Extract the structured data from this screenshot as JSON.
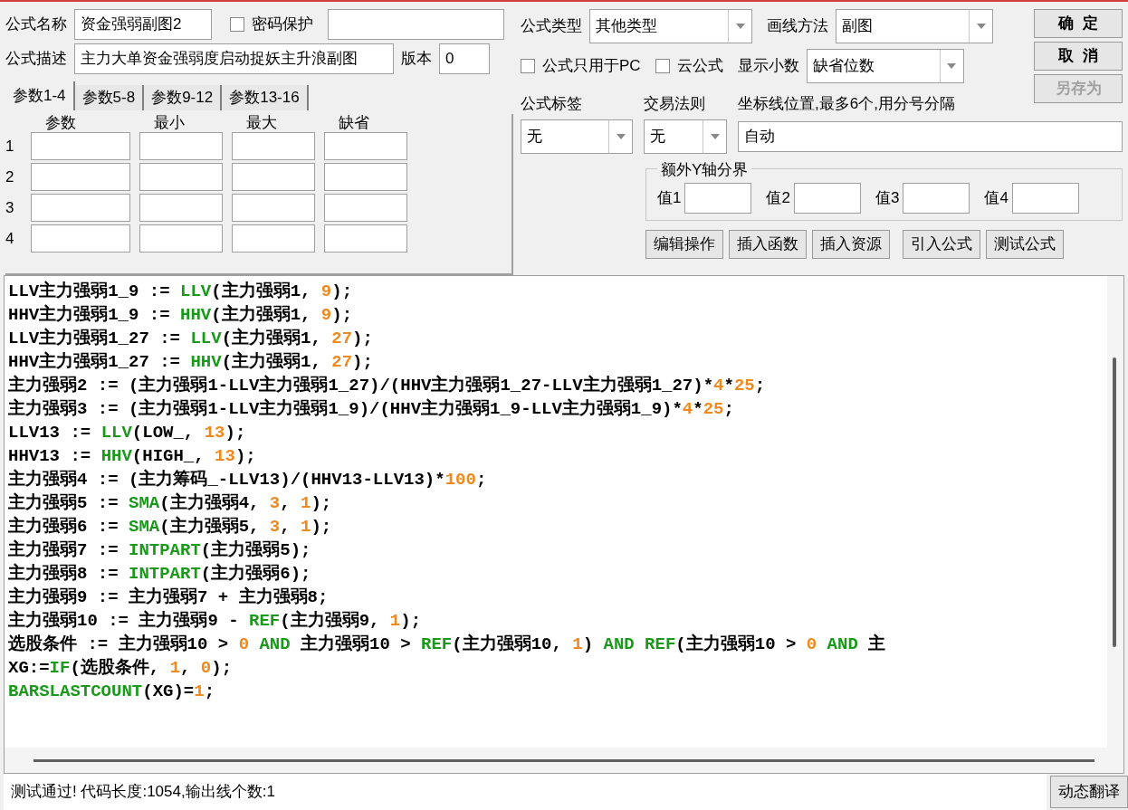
{
  "name_field": {
    "label": "公式名称",
    "value": "资金强弱副图2"
  },
  "password": {
    "label": "密码保护",
    "checked": false
  },
  "desc_field": {
    "label": "公式描述",
    "value": "主力大单资金强弱度启动捉妖主升浪副图"
  },
  "version": {
    "label": "版本",
    "value": "0"
  },
  "formula_type": {
    "label": "公式类型",
    "value": "其他类型"
  },
  "draw_method": {
    "label": "画线方法",
    "value": "副图"
  },
  "pc_only": {
    "label": "公式只用于PC",
    "checked": false
  },
  "cloud": {
    "label": "云公式",
    "checked": false
  },
  "decimals": {
    "label": "显示小数",
    "value": "缺省位数"
  },
  "buttons": [
    {
      "label": "确  定",
      "disabled": false
    },
    {
      "label": "取  消",
      "disabled": false
    },
    {
      "label": "另存为",
      "disabled": true
    }
  ],
  "tabs": [
    {
      "label": "参数1-4",
      "selected": true
    },
    {
      "label": "参数5-8",
      "selected": false
    },
    {
      "label": "参数9-12",
      "selected": false
    },
    {
      "label": "参数13-16",
      "selected": false
    }
  ],
  "param_columns": [
    "参数",
    "最小",
    "最大",
    "缺省"
  ],
  "param_rows": [
    "1",
    "2",
    "3",
    "4"
  ],
  "tag": {
    "label": "公式标签",
    "value": "无"
  },
  "trade_rule": {
    "label": "交易法则",
    "value": "无"
  },
  "axis": {
    "label": "坐标线位置,最多6个,用分号分隔",
    "value": "自动"
  },
  "y_bounds": {
    "title": "额外Y轴分界",
    "fields": [
      "值1",
      "值2",
      "值3",
      "值4"
    ]
  },
  "actions": [
    "编辑操作",
    "插入函数",
    "插入资源",
    "引入公式",
    "测试公式"
  ],
  "code": [
    [
      {
        "kind": "plain",
        "text": "LLV主力强弱1_9 := "
      },
      {
        "kind": "function",
        "text": "LLV"
      },
      {
        "kind": "plain",
        "text": "(主力强弱1, "
      },
      {
        "kind": "number",
        "text": "9"
      },
      {
        "kind": "plain",
        "text": ");"
      }
    ],
    [
      {
        "kind": "plain",
        "text": "HHV主力强弱1_9 := "
      },
      {
        "kind": "function",
        "text": "HHV"
      },
      {
        "kind": "plain",
        "text": "(主力强弱1, "
      },
      {
        "kind": "number",
        "text": "9"
      },
      {
        "kind": "plain",
        "text": ");"
      }
    ],
    [
      {
        "kind": "plain",
        "text": "LLV主力强弱1_27 := "
      },
      {
        "kind": "function",
        "text": "LLV"
      },
      {
        "kind": "plain",
        "text": "(主力强弱1, "
      },
      {
        "kind": "number",
        "text": "27"
      },
      {
        "kind": "plain",
        "text": ");"
      }
    ],
    [
      {
        "kind": "plain",
        "text": "HHV主力强弱1_27 := "
      },
      {
        "kind": "function",
        "text": "HHV"
      },
      {
        "kind": "plain",
        "text": "(主力强弱1, "
      },
      {
        "kind": "number",
        "text": "27"
      },
      {
        "kind": "plain",
        "text": ");"
      }
    ],
    [
      {
        "kind": "plain",
        "text": "主力强弱2 := (主力强弱1-LLV主力强弱1_27)/(HHV主力强弱1_27-LLV主力强弱1_27)*"
      },
      {
        "kind": "number",
        "text": "4"
      },
      {
        "kind": "plain",
        "text": "*"
      },
      {
        "kind": "number",
        "text": "25"
      },
      {
        "kind": "plain",
        "text": ";"
      }
    ],
    [
      {
        "kind": "plain",
        "text": "主力强弱3 := (主力强弱1-LLV主力强弱1_9)/(HHV主力强弱1_9-LLV主力强弱1_9)*"
      },
      {
        "kind": "number",
        "text": "4"
      },
      {
        "kind": "plain",
        "text": "*"
      },
      {
        "kind": "number",
        "text": "25"
      },
      {
        "kind": "plain",
        "text": ";"
      }
    ],
    [
      {
        "kind": "plain",
        "text": "LLV13 := "
      },
      {
        "kind": "function",
        "text": "LLV"
      },
      {
        "kind": "plain",
        "text": "(LOW_, "
      },
      {
        "kind": "number",
        "text": "13"
      },
      {
        "kind": "plain",
        "text": ");"
      }
    ],
    [
      {
        "kind": "plain",
        "text": "HHV13 := "
      },
      {
        "kind": "function",
        "text": "HHV"
      },
      {
        "kind": "plain",
        "text": "(HIGH_, "
      },
      {
        "kind": "number",
        "text": "13"
      },
      {
        "kind": "plain",
        "text": ");"
      }
    ],
    [
      {
        "kind": "plain",
        "text": "主力强弱4 := (主力筹码_-LLV13)/(HHV13-LLV13)*"
      },
      {
        "kind": "number",
        "text": "100"
      },
      {
        "kind": "plain",
        "text": ";"
      }
    ],
    [
      {
        "kind": "plain",
        "text": "主力强弱5 := "
      },
      {
        "kind": "function",
        "text": "SMA"
      },
      {
        "kind": "plain",
        "text": "(主力强弱4, "
      },
      {
        "kind": "number",
        "text": "3"
      },
      {
        "kind": "plain",
        "text": ", "
      },
      {
        "kind": "number",
        "text": "1"
      },
      {
        "kind": "plain",
        "text": ");"
      }
    ],
    [
      {
        "kind": "plain",
        "text": "主力强弱6 := "
      },
      {
        "kind": "function",
        "text": "SMA"
      },
      {
        "kind": "plain",
        "text": "(主力强弱5, "
      },
      {
        "kind": "number",
        "text": "3"
      },
      {
        "kind": "plain",
        "text": ", "
      },
      {
        "kind": "number",
        "text": "1"
      },
      {
        "kind": "plain",
        "text": ");"
      }
    ],
    [
      {
        "kind": "plain",
        "text": "主力强弱7 := "
      },
      {
        "kind": "function",
        "text": "INTPART"
      },
      {
        "kind": "plain",
        "text": "(主力强弱5);"
      }
    ],
    [
      {
        "kind": "plain",
        "text": "主力强弱8 := "
      },
      {
        "kind": "function",
        "text": "INTPART"
      },
      {
        "kind": "plain",
        "text": "(主力强弱6);"
      }
    ],
    [
      {
        "kind": "plain",
        "text": "主力强弱9 := 主力强弱7 + 主力强弱8;"
      }
    ],
    [
      {
        "kind": "plain",
        "text": "主力强弱10 := 主力强弱9 - "
      },
      {
        "kind": "function",
        "text": "REF"
      },
      {
        "kind": "plain",
        "text": "(主力强弱9, "
      },
      {
        "kind": "number",
        "text": "1"
      },
      {
        "kind": "plain",
        "text": ");"
      }
    ],
    [
      {
        "kind": "plain",
        "text": "选股条件 := 主力强弱10 > "
      },
      {
        "kind": "number",
        "text": "0"
      },
      {
        "kind": "function",
        "text": " AND"
      },
      {
        "kind": "plain",
        "text": " 主力强弱10 > "
      },
      {
        "kind": "function",
        "text": "REF"
      },
      {
        "kind": "plain",
        "text": "(主力强弱10, "
      },
      {
        "kind": "number",
        "text": "1"
      },
      {
        "kind": "plain",
        "text": ") "
      },
      {
        "kind": "function",
        "text": "AND REF"
      },
      {
        "kind": "plain",
        "text": "(主力强弱10 > "
      },
      {
        "kind": "number",
        "text": "0"
      },
      {
        "kind": "function",
        "text": " AND"
      },
      {
        "kind": "plain",
        "text": " 主"
      }
    ],
    [
      {
        "kind": "plain",
        "text": "XG:="
      },
      {
        "kind": "function",
        "text": "IF"
      },
      {
        "kind": "plain",
        "text": "(选股条件, "
      },
      {
        "kind": "number",
        "text": "1"
      },
      {
        "kind": "plain",
        "text": ", "
      },
      {
        "kind": "number",
        "text": "0"
      },
      {
        "kind": "plain",
        "text": ");"
      }
    ],
    [
      {
        "kind": "function",
        "text": "BARSLASTCOUNT"
      },
      {
        "kind": "plain",
        "text": "(XG)="
      },
      {
        "kind": "number",
        "text": "1"
      },
      {
        "kind": "plain",
        "text": ";"
      }
    ]
  ],
  "status": {
    "text": "测试通过! 代码长度:1054,输出线个数:1",
    "button": "动态翻译"
  }
}
